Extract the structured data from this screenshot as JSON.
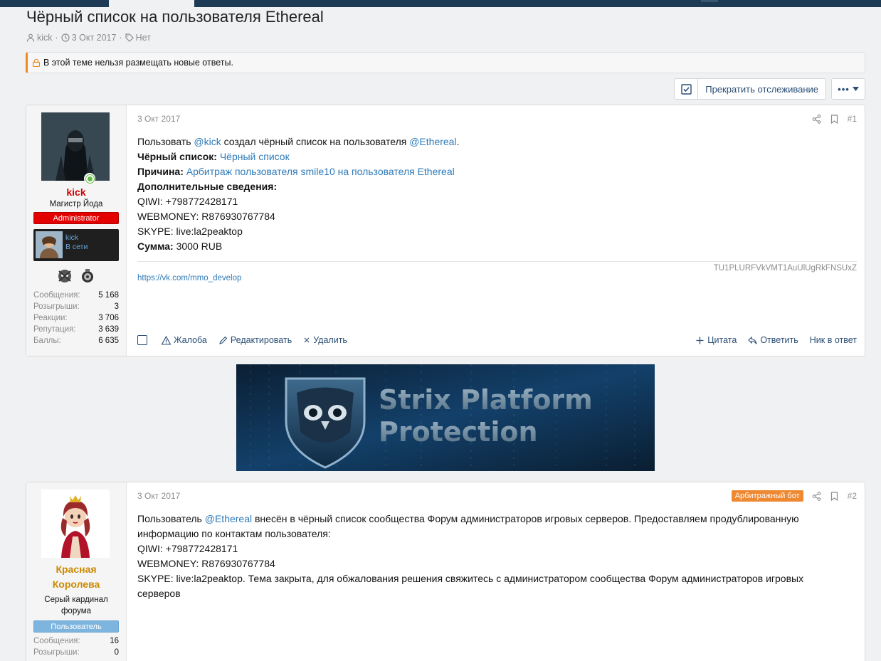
{
  "thread": {
    "title": "Чёрный список на пользователя Ethereal",
    "author": "kick",
    "date": "3 Окт 2017",
    "tags": "Нет",
    "locked_notice": "В этой теме нельзя размещать новые ответы."
  },
  "toolbar": {
    "unwatch_label": "Прекратить отслеживание",
    "more_label": "•••"
  },
  "posts": [
    {
      "user": {
        "name": "kick",
        "title": "Магистр Йода",
        "banner": "Administrator",
        "mini_name": "kick",
        "mini_status": "В сети",
        "stats": [
          {
            "k": "Сообщения:",
            "v": "5 168"
          },
          {
            "k": "Розыгрыши:",
            "v": "3"
          },
          {
            "k": "Реакции:",
            "v": "3 706"
          },
          {
            "k": "Репутация:",
            "v": "3 639"
          },
          {
            "k": "Баллы:",
            "v": "6 635"
          }
        ]
      },
      "date": "3 Окт 2017",
      "number": "#1",
      "body": {
        "l1_a": "Пользовать ",
        "l1_mention1": "@kick",
        "l1_b": " создал чёрный список на пользователя ",
        "l1_mention2": "@Ethereal",
        "l1_c": ".",
        "l2_label": "Чёрный список:",
        "l2_link": "Чёрный список",
        "l3_label": "Причина:",
        "l3_link": "Арбитраж пользователя smile10 на пользователя Ethereal",
        "l4_label": "Дополнительные сведения:",
        "l5": "QIWI: +798772428171",
        "l6": "WEBMONEY: R876930767784",
        "l7": "SKYPE: live:la2peaktop",
        "l8_label": "Сумма:",
        "l8_value": " 3000 RUB"
      },
      "signature": {
        "code": "TU1PLURFVkVMT1AuUlUgRkFNSUxZ",
        "url": "https://vk.com/mmo_develop"
      },
      "actions": {
        "report": "Жалоба",
        "edit": "Редактировать",
        "delete": "Удалить",
        "quote": "Цитата",
        "reply": "Ответить",
        "nick": "Ник в ответ"
      }
    },
    {
      "user": {
        "name_line1": "Красная",
        "name_line2": "Королева",
        "title_line1": "Серый кардинал",
        "title_line2": "форума",
        "banner": "Пользователь",
        "stats": [
          {
            "k": "Сообщения:",
            "v": "16"
          },
          {
            "k": "Розыгрыши:",
            "v": "0"
          }
        ]
      },
      "date": "3 Окт 2017",
      "badge": "Арбитражный бот",
      "number": "#2",
      "body": {
        "l1_a": "Пользователь ",
        "l1_mention": "@Ethereal",
        "l1_b": " внесён в чёрный список сообщества Форум администраторов игровых серверов. Предоставляем продублированную информацию по контактам пользователя:",
        "l2": "QIWI: +798772428171",
        "l3": "WEBMONEY: R876930767784",
        "l4": "SKYPE: live:la2peaktop. Тема закрыта, для обжалования решения свяжитесь с администратором сообщества Форум администраторов игровых серверов"
      }
    }
  ],
  "promo": {
    "line1": "Strix Platform",
    "line2": "Protection"
  },
  "colors": {
    "accent": "#2f7bb9",
    "admin_name": "#d40000",
    "admin_banner": "#e30000",
    "user_banner": "#7eb5de",
    "queen_name": "#cc8a00",
    "notice_border": "#ef8a25",
    "bot_badge": "#ee8932"
  }
}
